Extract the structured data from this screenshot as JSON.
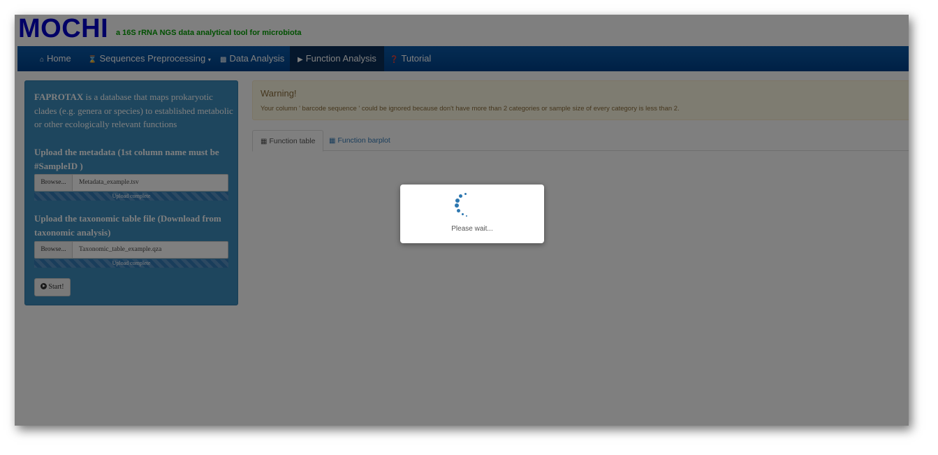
{
  "header": {
    "title": "MOCHI",
    "subtitle": "a 16S rRNA NGS data analytical tool for microbiota"
  },
  "navbar": {
    "items": [
      {
        "label": "Home",
        "icon": "home-icon"
      },
      {
        "label": "Sequences Preprocessing",
        "icon": "hourglass-icon",
        "dropdown": true
      },
      {
        "label": "Data Analysis",
        "icon": "chart-icon"
      },
      {
        "label": "Function Analysis",
        "icon": "play-square-icon",
        "active": true
      },
      {
        "label": "Tutorial",
        "icon": "question-circle-icon"
      }
    ]
  },
  "sidebar": {
    "desc_bold": "FAPROTAX",
    "desc_rest": " is a database that maps prokaryotic clades (e.g. genera or species) to established metabolic or other ecologically relevant functions",
    "metadata_heading": "Upload the metadata (1st column name must be #SampleID )",
    "metadata_browse": "Browse...",
    "metadata_file": "Metadata_example.tsv",
    "metadata_progress": "Upload complete",
    "metadata_progress_value": 1.0,
    "taxonomy_heading": "Upload the taxonomic table file (Download from taxonomic analysis)",
    "taxonomy_browse": "Browse...",
    "taxonomy_file": "Taxonomic_table_example.qza",
    "taxonomy_progress": "Upload complete",
    "taxonomy_progress_value": 1.0,
    "start_label": "Start!"
  },
  "warning": {
    "title": "Warning!",
    "text": "Your column ' barcode sequence ' could be ignored because don't have more than 2 categories or sample size of every category is less than 2."
  },
  "tabs": [
    {
      "label": "Function table",
      "icon": "table-icon",
      "active": true
    },
    {
      "label": "Function barplot",
      "icon": "grid-icon",
      "active": false
    }
  ],
  "modal": {
    "text": "Please wait..."
  },
  "colors": {
    "title": "#0000cc",
    "subtitle": "#00a000",
    "navbar": "#00418a",
    "sidebar": "#3c8dbc",
    "warning_bg": "#fcf8e3"
  }
}
